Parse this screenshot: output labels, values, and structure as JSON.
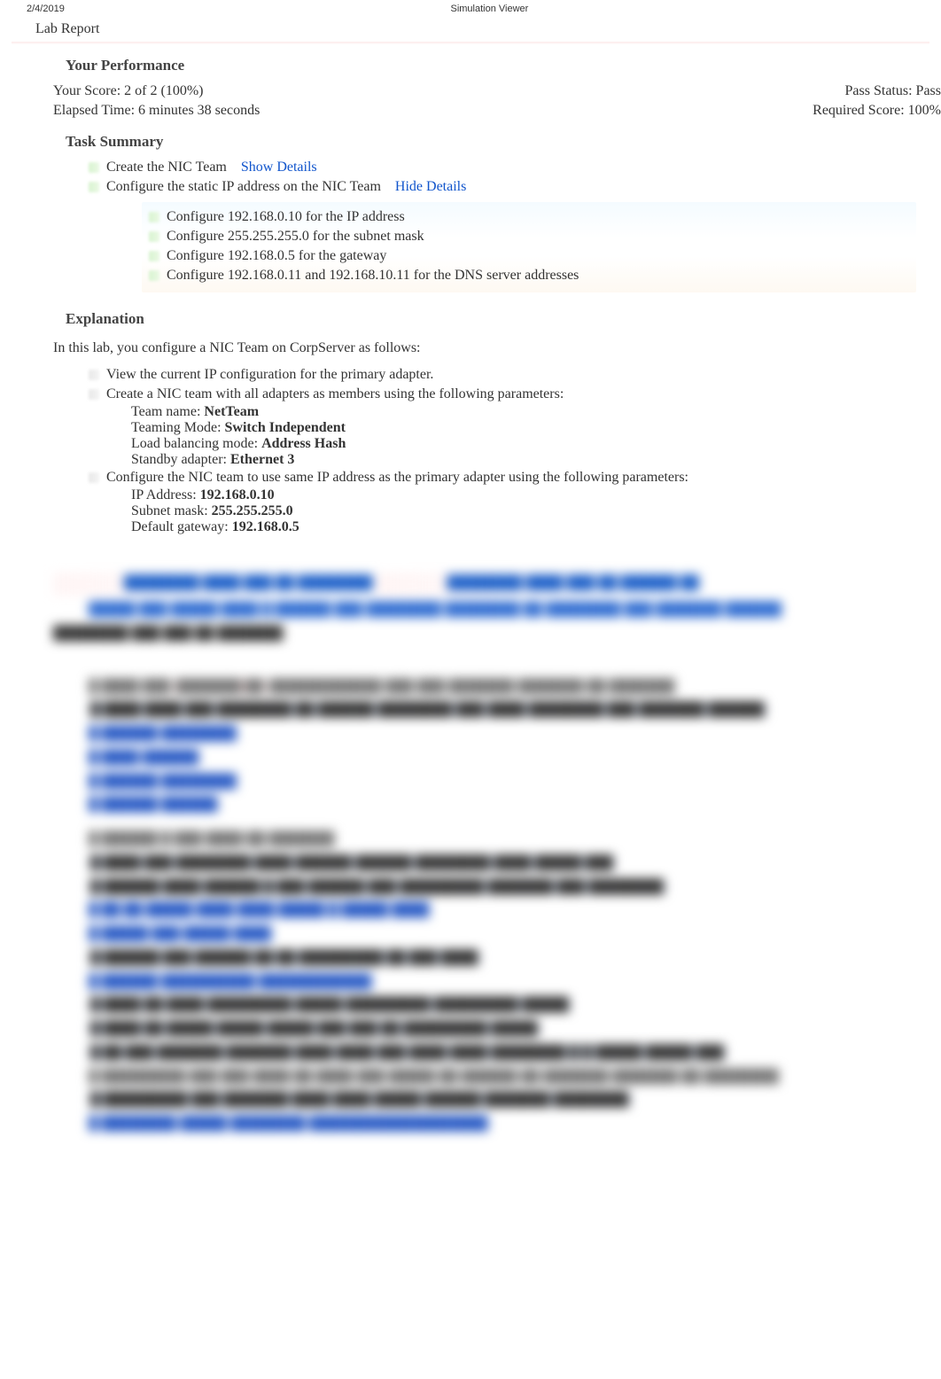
{
  "meta": {
    "date": "2/4/2019",
    "app_title": "Simulation Viewer"
  },
  "report_title": "Lab Report",
  "performance": {
    "heading": "Your Performance",
    "score_label": "Your Score: ",
    "score_value": "2 of 2 (100%)",
    "pass_label": "Pass Status: ",
    "pass_value": "Pass",
    "elapsed_label": "Elapsed Time: ",
    "elapsed_value": "6 minutes 38 seconds",
    "required_label": "Required Score: ",
    "required_value": "100%"
  },
  "task_summary": {
    "heading": "Task Summary",
    "items": [
      {
        "label": "Create the NIC Team",
        "toggle": "Show Details"
      },
      {
        "label": "Configure the static IP address on the NIC Team",
        "toggle": "Hide Details"
      }
    ],
    "details": [
      "Configure 192.168.0.10 for the IP address",
      "Configure 255.255.255.0 for the subnet mask",
      "Configure 192.168.0.5 for the gateway",
      "Configure 192.168.0.11 and 192.168.10.11 for the DNS server addresses"
    ]
  },
  "explanation": {
    "heading": "Explanation",
    "intro": "In this lab, you configure a NIC Team on CorpServer as follows:",
    "b1": "View the current IP configuration for the primary adapter.",
    "b2": "Create a NIC team with all adapters as members using the following parameters:",
    "b2_sub": {
      "team_name_label": "Team name: ",
      "team_name_value": "NetTeam",
      "teaming_mode_label": "Teaming Mode: ",
      "teaming_mode_value": "Switch Independent",
      "lb_label": "Load balancing mode: ",
      "lb_value": "Address Hash",
      "standby_label": "Standby adapter: ",
      "standby_value": "Ethernet 3"
    },
    "b3": "Configure the NIC team to use same IP address as the primary adapter using the following parameters:",
    "b3_sub": {
      "ip_label": "IP Address: ",
      "ip_value": "192.168.0.10",
      "mask_label": "Subnet mask: ",
      "mask_value": "255.255.255.0",
      "gw_label": "Default gateway: ",
      "gw_value": "192.168.0.5"
    }
  }
}
